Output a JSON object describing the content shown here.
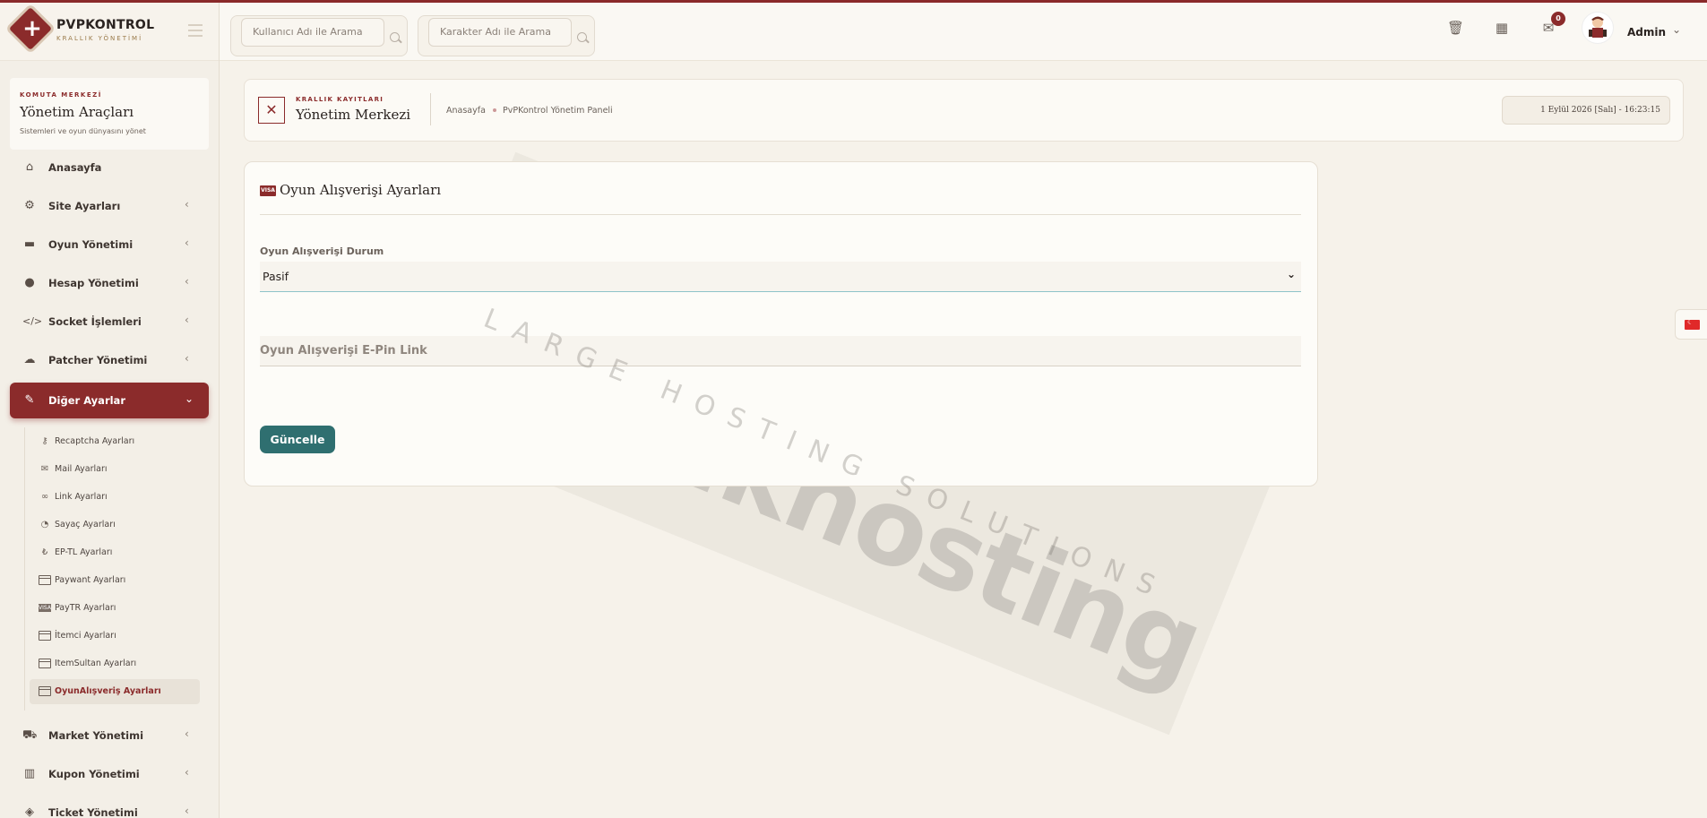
{
  "brand": {
    "title": "PVPKONTROL",
    "subtitle": "KRALLIK YÖNETİMİ"
  },
  "sidebar": {
    "section_kicker": "KOMUTA MERKEZİ",
    "section_title": "Yönetim Araçları",
    "section_desc": "Sistemleri ve oyun dünyasını yönet",
    "items": [
      {
        "label": "Anasayfa",
        "icon": "home-icon"
      },
      {
        "label": "Site Ayarları",
        "icon": "gear-icon"
      },
      {
        "label": "Oyun Yönetimi",
        "icon": "gamepad-icon"
      },
      {
        "label": "Hesap Yönetimi",
        "icon": "users-icon"
      },
      {
        "label": "Socket İşlemleri",
        "icon": "code-icon"
      },
      {
        "label": "Patcher Yönetimi",
        "icon": "cloud-icon"
      },
      {
        "label": "Diğer Ayarlar",
        "icon": "wrench-icon",
        "expanded": true
      },
      {
        "label": "Market Yönetimi",
        "icon": "cart-icon"
      },
      {
        "label": "Kupon Yönetimi",
        "icon": "barcode-icon"
      },
      {
        "label": "Ticket Yönetimi",
        "icon": "ticket-icon"
      }
    ],
    "subitems": [
      {
        "label": "Recaptcha Ayarları",
        "icon": "key-icon"
      },
      {
        "label": "Mail Ayarları",
        "icon": "envelope-icon"
      },
      {
        "label": "Link Ayarları",
        "icon": "link-icon"
      },
      {
        "label": "Sayaç Ayarları",
        "icon": "gauge-icon"
      },
      {
        "label": "EP-TL Ayarları",
        "icon": "coin-icon"
      },
      {
        "label": "Paywant Ayarları",
        "icon": "credit-card-icon"
      },
      {
        "label": "PayTR Ayarları",
        "icon": "visa-card-icon"
      },
      {
        "label": "İtemci Ayarları",
        "icon": "credit-card-icon"
      },
      {
        "label": "ItemSultan Ayarları",
        "icon": "credit-card-icon"
      },
      {
        "label": "OyunAlışveriş Ayarları",
        "icon": "credit-card-icon",
        "active": true
      }
    ]
  },
  "topbar": {
    "search_user_placeholder": "Kullanıcı Adı ile Arama",
    "search_char_placeholder": "Karakter Adı ile Arama",
    "notifications_count": "0",
    "admin_name": "Admin"
  },
  "header": {
    "kicker": "KRALLIK KAYITLARI",
    "title": "Yönetim Merkezi",
    "breadcrumb": [
      "Anasayfa",
      "PvPKontrol Yönetim Paneli"
    ],
    "datetime": "1 Eylül 2026 [Salı] - 16:23:15"
  },
  "settings_card": {
    "icon_text": "VISA",
    "title": "Oyun Alışverişi Ayarları",
    "status_label": "Oyun Alışverişi Durum",
    "status_value": "Pasif",
    "epin_placeholder": "Oyun Alışverişi E-Pin Link",
    "submit_label": "Güncelle"
  },
  "watermark": {
    "brand": "buyukhosting",
    "tagline": "LARGE HOSTING SOLUTIONS"
  },
  "colors": {
    "accent": "#8b2b2b",
    "button": "#2f6f70",
    "background": "#f6f2ea"
  }
}
